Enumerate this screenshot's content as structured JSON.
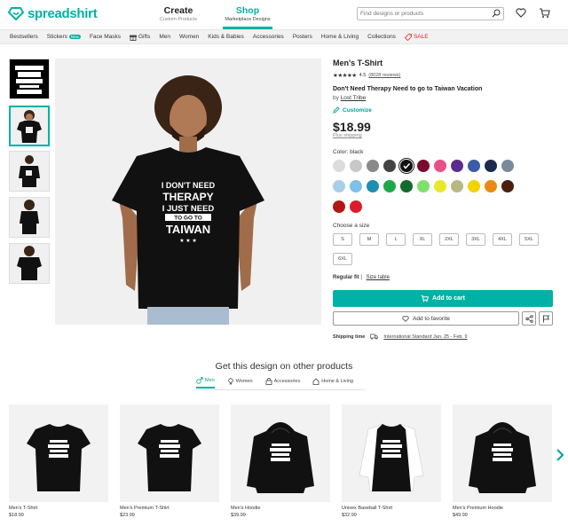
{
  "header": {
    "logo": "spreadshirt",
    "create": {
      "title": "Create",
      "sub": "Custom Products"
    },
    "shop": {
      "title": "Shop",
      "sub": "Marketplace Designs"
    },
    "search_placeholder": "Find designs or products"
  },
  "categories": [
    {
      "label": "Bestsellers"
    },
    {
      "label": "Stickers",
      "badge": "New"
    },
    {
      "label": "Face Masks"
    },
    {
      "label": "Gifts",
      "icon": "gift-icon"
    },
    {
      "label": "Men"
    },
    {
      "label": "Women"
    },
    {
      "label": "Kids & Babies"
    },
    {
      "label": "Accessories"
    },
    {
      "label": "Posters"
    },
    {
      "label": "Home & Living"
    },
    {
      "label": "Collections"
    },
    {
      "label": "SALE",
      "icon": "tag-icon"
    }
  ],
  "main_image": {
    "shirt_text": [
      "I DON'T NEED",
      "THERAPY",
      "I JUST NEED",
      "TO GO TO",
      "TAIWAN"
    ]
  },
  "product": {
    "title": "Men's T-Shirt",
    "rating": "4.5",
    "reviews": "(8028 reviews)",
    "design_title": "Don't Need Therapy Need to go to Taiwan Vacation",
    "by_label": "by",
    "designer": "Lost Tribe",
    "customize": "Customize",
    "price": "$18.99",
    "plus_shipping": "Plus shipping",
    "color_label": "Color: black",
    "size_label": "Choose a size",
    "sizes": [
      "S",
      "M",
      "L",
      "XL",
      "2XL",
      "3XL",
      "4XL",
      "5XL",
      "6XL"
    ],
    "fit_label": "Regular fit",
    "size_table": "Size table",
    "add_to_cart": "Add to cart",
    "add_to_favorites": "Add to favorite",
    "shipping_label": "Shipping time",
    "shipping_value": "International Standard Jan. 25 - Feb. 9"
  },
  "swatches": [
    "#dcdcdc",
    "#c8c8c8",
    "#8a8a8a",
    "#444444",
    "#111111",
    "#7a0a2e",
    "#e8508a",
    "#5b2c8f",
    "#3a5ba8",
    "#1c2a4e",
    "#7a8a9a",
    "#a8cfe8",
    "#7ec0e6",
    "#1e8fb0",
    "#1fa84a",
    "#116b2b",
    "#7ee06b",
    "#e8e82a",
    "#b8b884",
    "#f5d100",
    "#ea8a12",
    "#4a1e0e",
    "#b01818",
    "#d91e2a"
  ],
  "selected_swatch": 4,
  "other": {
    "title": "Get this design on other products",
    "tabs": [
      {
        "label": "Men",
        "icon": "male-icon"
      },
      {
        "label": "Women",
        "icon": "female-icon"
      },
      {
        "label": "Accessories",
        "icon": "bag-icon"
      },
      {
        "label": "Home & Living",
        "icon": "home-icon"
      }
    ],
    "products": [
      {
        "name": "Men's T-Shirt",
        "price": "$18.99",
        "type": "tee"
      },
      {
        "name": "Men's Premium T-Shirt",
        "price": "$23.99",
        "type": "tee"
      },
      {
        "name": "Men's Hoodie",
        "price": "$39.99",
        "type": "hoodie"
      },
      {
        "name": "Unisex Baseball T-Shirt",
        "price": "$32.99",
        "type": "raglan"
      },
      {
        "name": "Men's Premium Hoodie",
        "price": "$49.99",
        "type": "hoodie"
      }
    ]
  }
}
